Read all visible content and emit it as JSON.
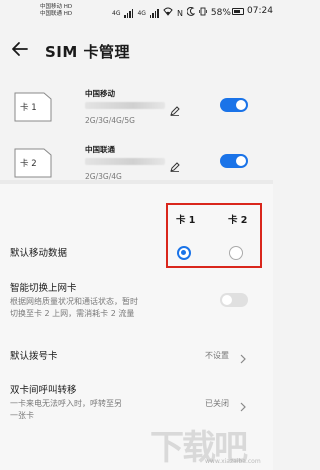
{
  "status_bar": {
    "carrier_1": "中国移动 HD",
    "carrier_2": "中国联通 HD",
    "network_1": "4G",
    "network_2": "4G",
    "battery_percent": "58%",
    "time": "07:24"
  },
  "header": {
    "title": "SIM 卡管理"
  },
  "sims": [
    {
      "slot_label": "卡 1",
      "carrier": "中国移动",
      "network": "2G/3G/4G/5G",
      "enabled": true
    },
    {
      "slot_label": "卡 2",
      "carrier": "中国联通",
      "network": "2G/3G/4G",
      "enabled": true
    }
  ],
  "default_data": {
    "column_1": "卡 1",
    "column_2": "卡 2",
    "label": "默认移动数据",
    "selected": "卡 1"
  },
  "smart_switch": {
    "title": "智能切换上网卡",
    "desc_line_1": "根据网络质量状况和通话状态，暂时",
    "desc_line_2": "切换至卡 2 上网，需消耗卡 2 流量",
    "enabled": false
  },
  "default_dial": {
    "title": "默认拨号卡",
    "value": "不设置"
  },
  "call_forward": {
    "title": "双卡间呼叫转移",
    "desc_line_1": "一卡来电无法呼入时，呼转至另",
    "desc_line_2": "一张卡",
    "value": "已关闭"
  },
  "watermark": {
    "text": "下载吧",
    "url": "www.xiazaiba.com"
  },
  "colors": {
    "accent": "#1a73e8",
    "highlight": "#d9261c"
  }
}
